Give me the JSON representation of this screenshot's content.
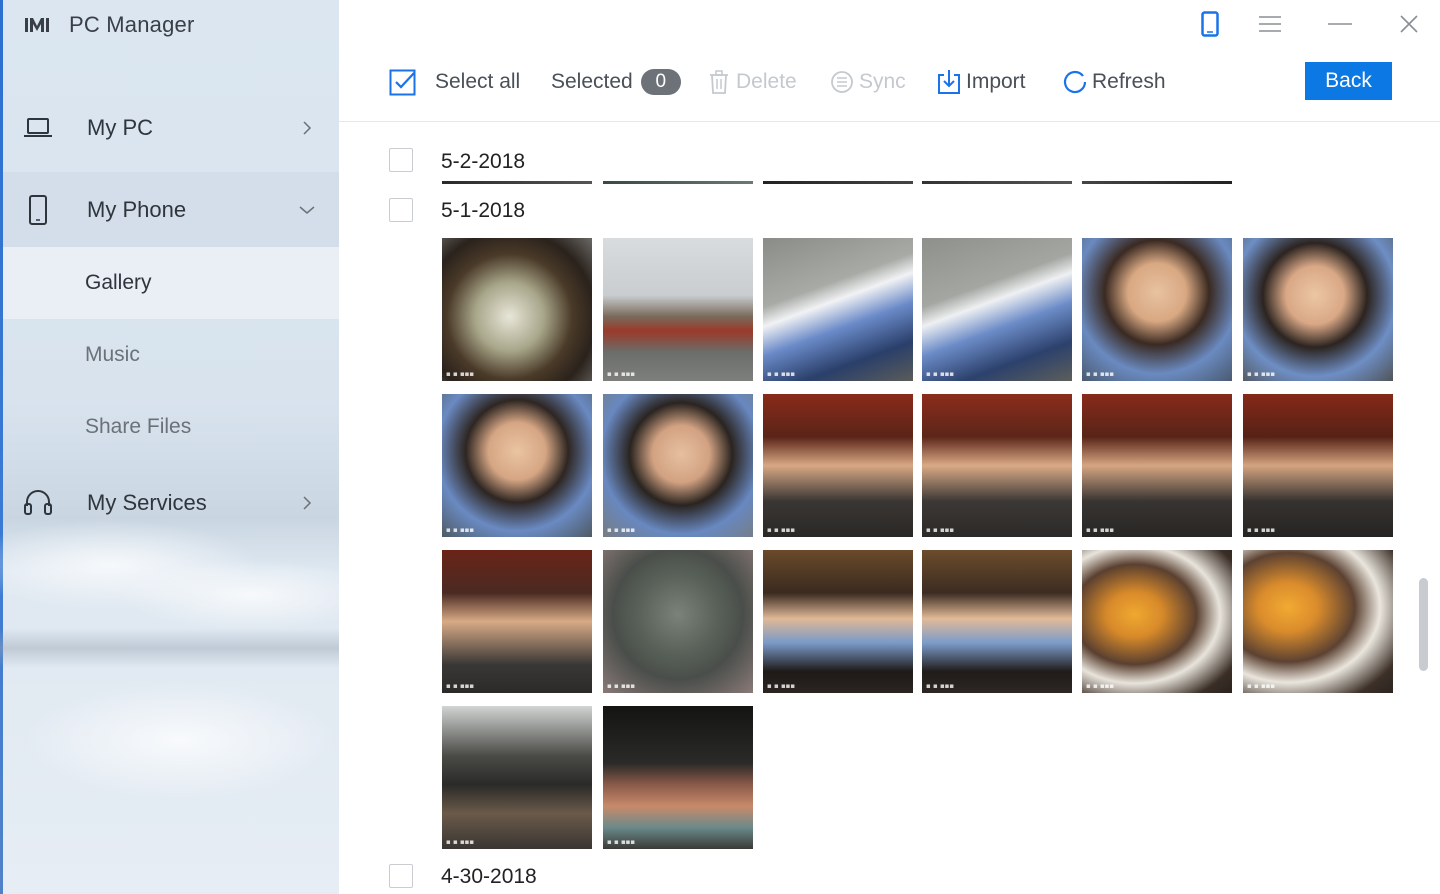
{
  "app": {
    "title": "PC Manager"
  },
  "sidebar": {
    "items": [
      {
        "label": "My PC",
        "icon": "laptop-icon",
        "expanded": false
      },
      {
        "label": "My Phone",
        "icon": "phone-icon",
        "expanded": true
      },
      {
        "label": "My Services",
        "icon": "headset-icon",
        "expanded": false
      }
    ],
    "phone_subitems": [
      {
        "label": "Gallery",
        "active": true
      },
      {
        "label": "Music",
        "active": false
      },
      {
        "label": "Share Files",
        "active": false
      }
    ]
  },
  "window": {
    "controls": [
      "phone-icon",
      "menu-icon",
      "minimize-icon",
      "close-icon"
    ]
  },
  "toolbar": {
    "select_all_label": "Select all",
    "select_all_checked": true,
    "selected_label": "Selected",
    "selected_count": "0",
    "delete_label": "Delete",
    "sync_label": "Sync",
    "import_label": "Import",
    "refresh_label": "Refresh",
    "back_label": "Back",
    "accent_color": "#0b78e3"
  },
  "gallery": {
    "groups": [
      {
        "date": "5-2-2018",
        "photo_count_visible": 5
      },
      {
        "date": "5-1-2018",
        "photo_count_visible": 20
      },
      {
        "date": "4-30-2018",
        "photo_count_visible": 0
      }
    ],
    "photos_5_1_2018": [
      "food-bowl-photo",
      "temple-plaza-photo",
      "boy-phone-photo",
      "boy-phone-photo-2",
      "boy-face-photo",
      "boy-shout-photo",
      "boy-shout-photo-2",
      "boy-shout-photo-3",
      "selfie-man-boy-photo",
      "selfie-man-boy-photo-2",
      "selfie-man-boy-photo-3",
      "selfie-man-boy-photo-4",
      "selfie-man-boy-photo-5",
      "stone-lion-photo",
      "boy-table-photo",
      "boy-table-photo-2",
      "drink-tart-photo",
      "drink-tart-photo-2",
      "cafe-interior-photo",
      "tumblers-photo"
    ]
  }
}
